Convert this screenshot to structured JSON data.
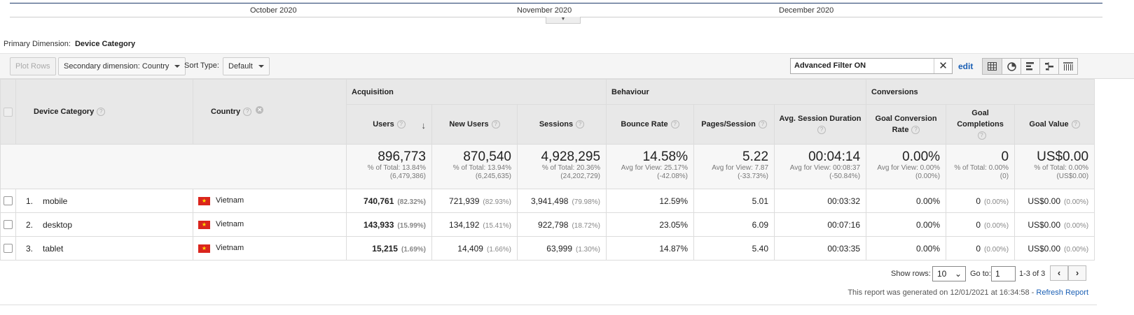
{
  "timeline": {
    "months": [
      "October 2020",
      "November 2020",
      "December 2020"
    ]
  },
  "primary_dimension": {
    "label": "Primary Dimension:",
    "value": "Device Category"
  },
  "toolbar": {
    "plot_rows": "Plot Rows",
    "secondary_dimension": "Secondary dimension: Country",
    "sort_type_label": "Sort Type:",
    "sort_type_value": "Default",
    "filter_text": "Advanced Filter ON",
    "edit": "edit"
  },
  "table": {
    "groups": [
      "Acquisition",
      "Behaviour",
      "Conversions"
    ],
    "headers": {
      "device_category": "Device Category",
      "country": "Country",
      "users": "Users",
      "new_users": "New Users",
      "sessions": "Sessions",
      "bounce_rate": "Bounce Rate",
      "pages_session": "Pages/Session",
      "avg_session_duration": "Avg. Session Duration",
      "goal_conversion_rate": "Goal Conversion Rate",
      "goal_completions": "Goal Completions",
      "goal_value": "Goal Value"
    },
    "totals": {
      "users": {
        "value": "896,773",
        "sub1": "% of Total: 13.84%",
        "sub2": "(6,479,386)"
      },
      "new_users": {
        "value": "870,540",
        "sub1": "% of Total: 13.94%",
        "sub2": "(6,245,635)"
      },
      "sessions": {
        "value": "4,928,295",
        "sub1": "% of Total: 20.36%",
        "sub2": "(24,202,729)"
      },
      "bounce_rate": {
        "value": "14.58%",
        "sub1": "Avg for View: 25.17%",
        "sub2": "(-42.08%)"
      },
      "pages_session": {
        "value": "5.22",
        "sub1": "Avg for View: 7.87",
        "sub2": "(-33.73%)"
      },
      "avg_session_duration": {
        "value": "00:04:14",
        "sub1": "Avg for View: 00:08:37",
        "sub2": "(-50.84%)"
      },
      "goal_conversion_rate": {
        "value": "0.00%",
        "sub1": "Avg for View: 0.00%",
        "sub2": "(0.00%)"
      },
      "goal_completions": {
        "value": "0",
        "sub1": "% of Total: 0.00%",
        "sub2": "(0)"
      },
      "goal_value": {
        "value": "US$0.00",
        "sub1": "% of Total: 0.00%",
        "sub2": "(US$0.00)"
      }
    },
    "rows": [
      {
        "index": "1.",
        "device": "mobile",
        "country": "Vietnam",
        "users": "740,761",
        "users_pct": "(82.32%)",
        "new_users": "721,939",
        "new_users_pct": "(82.93%)",
        "sessions": "3,941,498",
        "sessions_pct": "(79.98%)",
        "bounce_rate": "12.59%",
        "pages_session": "5.01",
        "avg_duration": "00:03:32",
        "conv_rate": "0.00%",
        "completions": "0",
        "completions_pct": "(0.00%)",
        "goal_value": "US$0.00",
        "goal_value_pct": "(0.00%)"
      },
      {
        "index": "2.",
        "device": "desktop",
        "country": "Vietnam",
        "users": "143,933",
        "users_pct": "(15.99%)",
        "new_users": "134,192",
        "new_users_pct": "(15.41%)",
        "sessions": "922,798",
        "sessions_pct": "(18.72%)",
        "bounce_rate": "23.05%",
        "pages_session": "6.09",
        "avg_duration": "00:07:16",
        "conv_rate": "0.00%",
        "completions": "0",
        "completions_pct": "(0.00%)",
        "goal_value": "US$0.00",
        "goal_value_pct": "(0.00%)"
      },
      {
        "index": "3.",
        "device": "tablet",
        "country": "Vietnam",
        "users": "15,215",
        "users_pct": "(1.69%)",
        "new_users": "14,409",
        "new_users_pct": "(1.66%)",
        "sessions": "63,999",
        "sessions_pct": "(1.30%)",
        "bounce_rate": "14.87%",
        "pages_session": "5.40",
        "avg_duration": "00:03:35",
        "conv_rate": "0.00%",
        "completions": "0",
        "completions_pct": "(0.00%)",
        "goal_value": "US$0.00",
        "goal_value_pct": "(0.00%)"
      }
    ]
  },
  "pager": {
    "show_rows_label": "Show rows:",
    "show_rows_value": "10",
    "goto_label": "Go to:",
    "goto_value": "1",
    "range": "1-3 of 3"
  },
  "footer": {
    "generated": "This report was generated on 12/01/2021 at 16:34:58 - ",
    "refresh": "Refresh Report"
  },
  "colors": {
    "accent_link": "#1a5fb4",
    "flag_red": "#da251d",
    "flag_star": "#ffde00"
  }
}
